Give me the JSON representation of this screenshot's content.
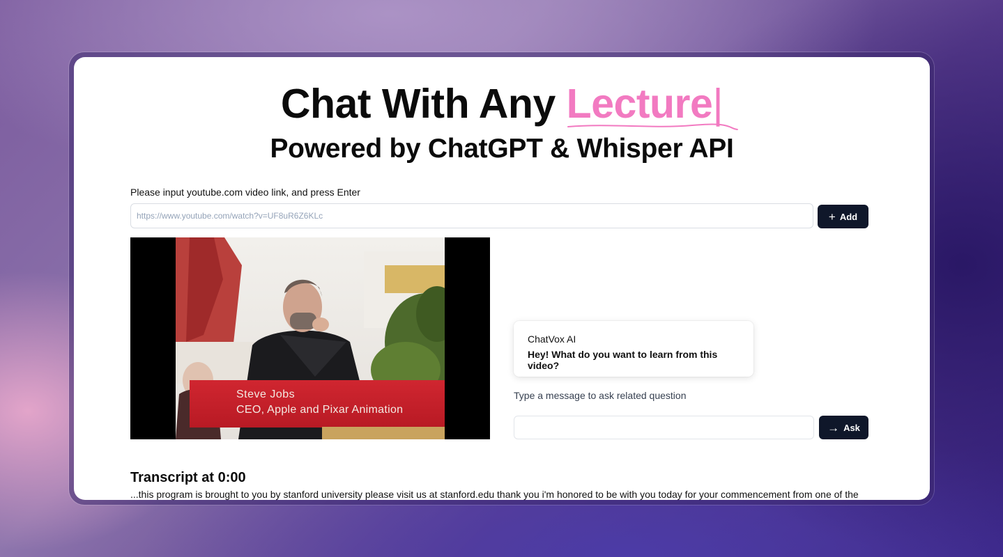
{
  "hero": {
    "title_prefix": "Chat With Any ",
    "title_accent": "Lecture",
    "title_cursor": "|",
    "subtitle": "Powered by ChatGPT & Whisper API"
  },
  "url_form": {
    "label": "Please input youtube.com video link, and press Enter",
    "placeholder": "https://www.youtube.com/watch?v=UF8uR6Z6KLc",
    "add_label": "Add"
  },
  "video": {
    "caption_name": "Steve Jobs",
    "caption_role": "CEO, Apple and Pixar Animation"
  },
  "chat": {
    "sender": "ChatVox AI",
    "message": "Hey! What do you want to learn from this video?",
    "input_label": "Type a message to ask related question",
    "ask_label": "Ask"
  },
  "transcript": {
    "title": "Transcript at 0:00",
    "text": "...this program is brought to you by stanford university please visit us at stanford.edu thank you i'm honored to be with you today for your commencement from one of the"
  },
  "colors": {
    "accent": "#f27ac1",
    "button_bg": "#0f172a",
    "caption_bar": "#c8202a"
  }
}
